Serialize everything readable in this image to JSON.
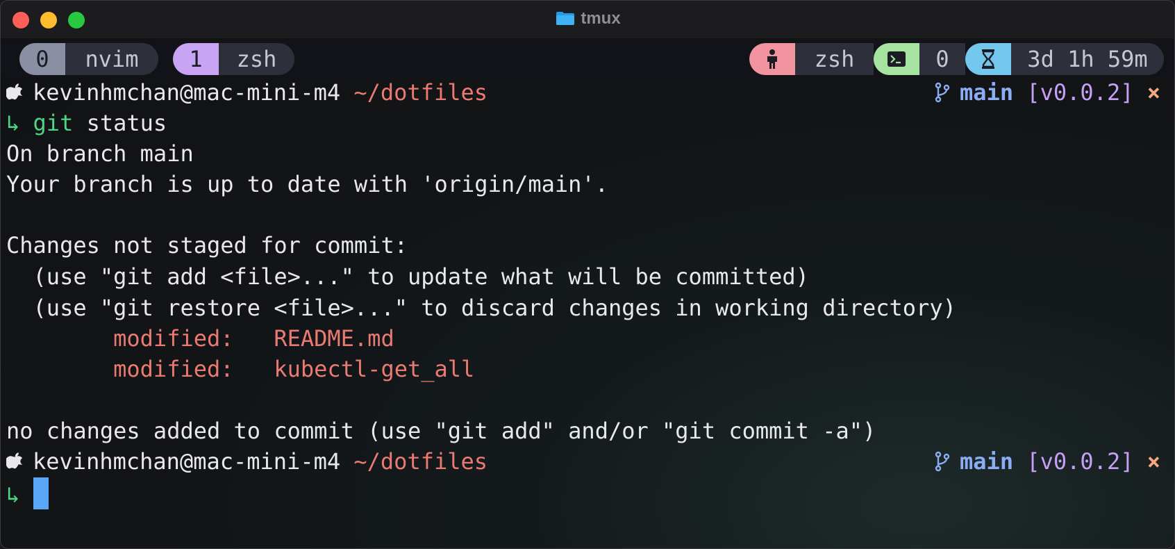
{
  "window": {
    "title": "tmux"
  },
  "tmux": {
    "windows": [
      {
        "index": "0",
        "name": "nvim"
      },
      {
        "index": "1",
        "name": "zsh"
      }
    ],
    "status_right": {
      "session": "zsh",
      "pane_count": "0",
      "uptime": "3d 1h 59m"
    }
  },
  "prompt": {
    "user_host": "kevinhmchan@mac-mini-m4",
    "cwd": "~/dotfiles",
    "branch": "main",
    "tag": "[v0.0.2]",
    "dirty_mark": "×",
    "arrow": "↳"
  },
  "command": {
    "program": "git",
    "args": "status"
  },
  "output": {
    "line1": "On branch main",
    "line2": "Your branch is up to date with 'origin/main'.",
    "line3": "Changes not staged for commit:",
    "line4": "  (use \"git add <file>...\" to update what will be committed)",
    "line5": "  (use \"git restore <file>...\" to discard changes in working directory)",
    "modified_label": "modified:",
    "files": [
      "README.md",
      "kubectl-get_all"
    ],
    "line_final": "no changes added to commit (use \"git add\" and/or \"git commit -a\")"
  },
  "icons": {
    "apple": "apple-icon",
    "branch": "git-branch-icon",
    "folder": "folder-icon",
    "person": "person-icon",
    "terminal": "terminal-icon",
    "hourglass": "hourglass-icon"
  },
  "colors": {
    "accent_red": "#eb7a73",
    "accent_green": "#4fd586",
    "accent_blue": "#8aadf4",
    "accent_purple": "#c6a0f6",
    "accent_orange": "#f5a97f",
    "cursor": "#5aa7f5"
  }
}
